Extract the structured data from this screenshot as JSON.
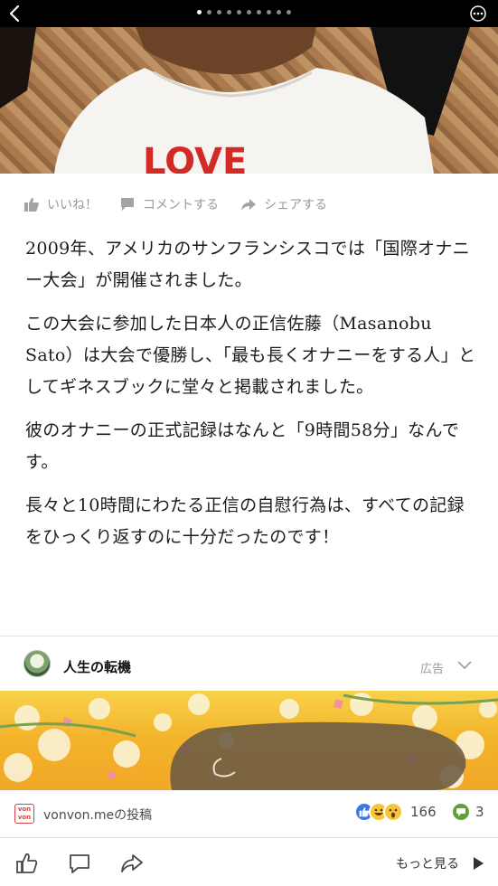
{
  "pager": {
    "count": 10,
    "active_index": 0
  },
  "photo": {
    "shirt_text": "LOVE"
  },
  "actions": {
    "like": "いいね！",
    "comment": "コメントする",
    "share": "シェアする"
  },
  "article": {
    "paragraphs": [
      "2009年、アメリカのサンフランシスコでは「国際オナニー大会」が開催されました。",
      "この大会に参加した日本人の正信佐藤（Masanobu Sato）は大会で優勝し、「最も長くオナニーをする人」としてギネスブックに堂々と掲載されました。",
      "彼のオナニーの正式記録はなんと「9時間58分」なんです。",
      "長々と10時間にわたる正信の自慰行為は、すべての記録をひっくり返すのに十分だったのです！"
    ]
  },
  "ad": {
    "title": "人生の転機",
    "label": "広告"
  },
  "source": {
    "logo_line1": "von",
    "logo_line2": "von",
    "text": "vonvon.meの投稿",
    "reaction_count": "166",
    "comment_count": "3"
  },
  "bottom": {
    "see_more": "もっと見る"
  },
  "colors": {
    "like_blue": "#3b78e7",
    "comment_green": "#5fa03b",
    "ad_banner": "#f3b52c",
    "photo_brown": "#a5764a"
  }
}
